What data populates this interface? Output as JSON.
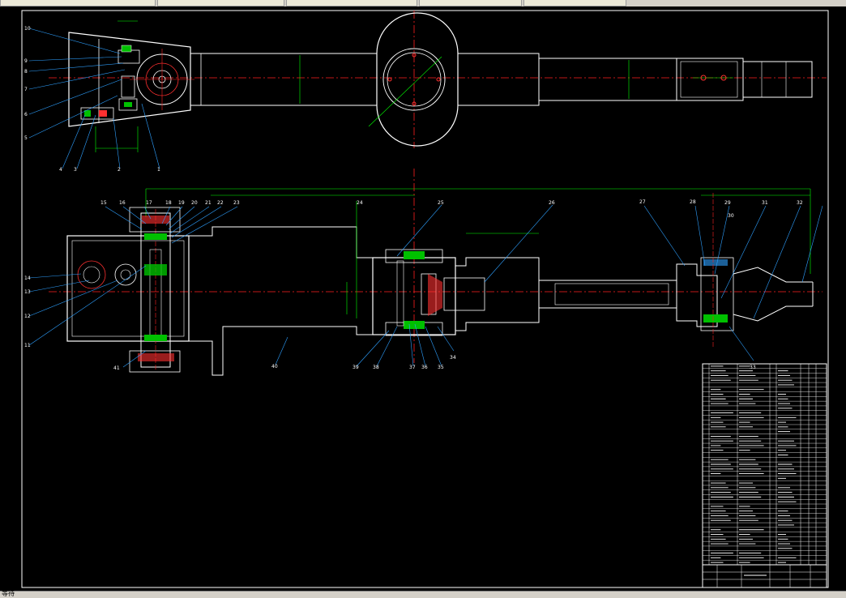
{
  "window": {
    "tabs": [
      "",
      "",
      "",
      "",
      "",
      ""
    ],
    "command_text": "等待"
  },
  "drawing": {
    "colors": {
      "background": "#000000",
      "outline": "#ffffff",
      "centerline": "#ff2020",
      "dimension": "#00ff00",
      "leader": "#2ea0ff",
      "hatch": "#ff3030",
      "table_text": "#ffffff",
      "table_line": "#ffffff"
    },
    "top_view_labels": [
      "10",
      "9",
      "8",
      "7",
      "6",
      "5",
      "4",
      "3",
      "2",
      "1"
    ],
    "front_view_labels_top": [
      "15",
      "16",
      "17",
      "18",
      "19",
      "20",
      "21",
      "22",
      "23",
      "24",
      "25",
      "26",
      "27",
      "28",
      "29",
      "30",
      "31",
      "32"
    ],
    "front_view_labels_left": [
      "14",
      "13",
      "12",
      "11"
    ],
    "front_view_labels_bottom": [
      "41",
      "40",
      "39",
      "38",
      "37",
      "36",
      "35",
      "34",
      "33"
    ],
    "parts_rows": 43
  }
}
